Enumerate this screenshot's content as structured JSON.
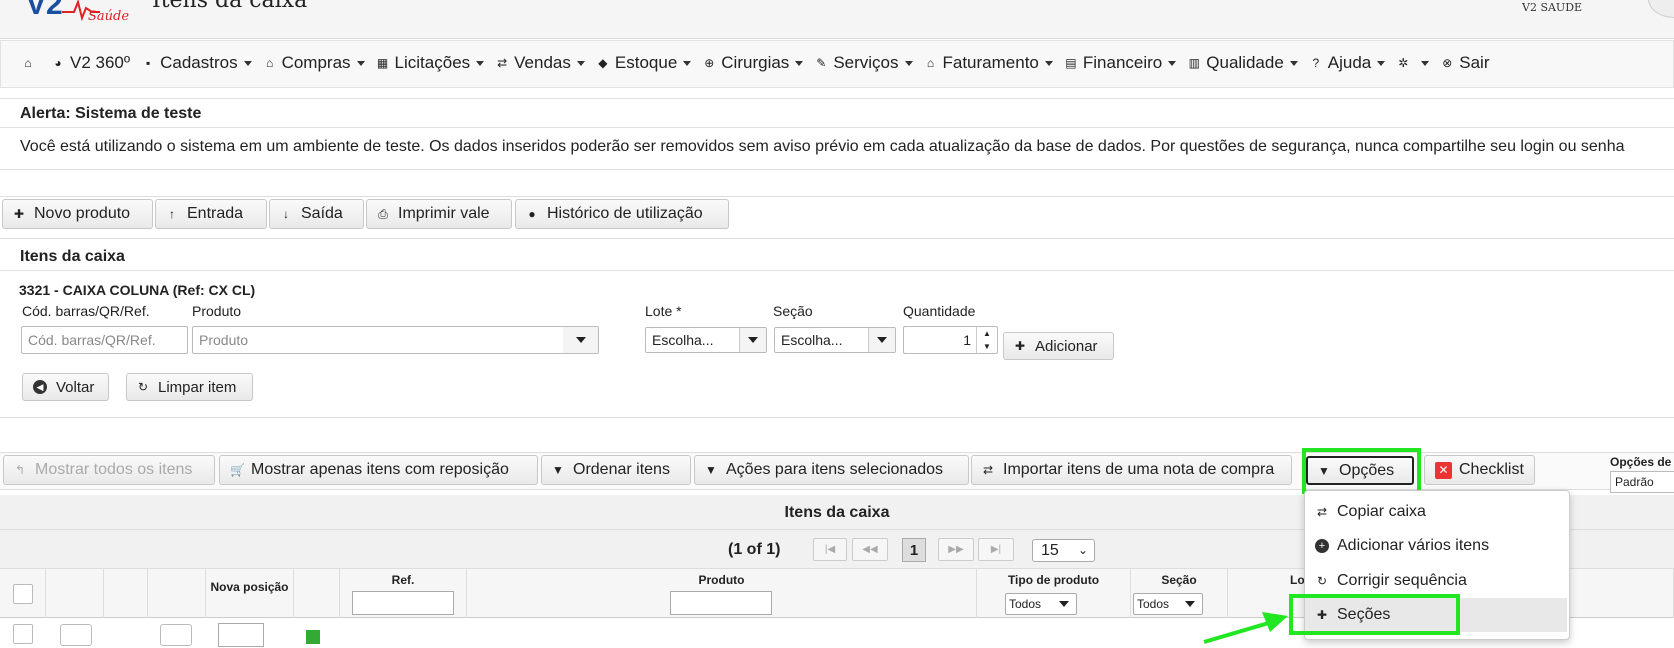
{
  "header": {
    "title": "Itens da caixa",
    "brand": "V2 SAUDE",
    "logo_text": "Saúde"
  },
  "nav": {
    "items": [
      {
        "icon": "home-icon",
        "label": ""
      },
      {
        "icon": "pie-chart-icon",
        "label": "V2 360º"
      },
      {
        "icon": "save-icon",
        "label": "Cadastros"
      },
      {
        "icon": "bank-icon",
        "label": "Compras"
      },
      {
        "icon": "building-icon",
        "label": "Licitações"
      },
      {
        "icon": "swap-icon",
        "label": "Vendas"
      },
      {
        "icon": "tag-icon",
        "label": "Estoque"
      },
      {
        "icon": "plus-circle-icon",
        "label": "Cirurgias"
      },
      {
        "icon": "wrench-icon",
        "label": "Serviços"
      },
      {
        "icon": "bank-icon",
        "label": "Faturamento"
      },
      {
        "icon": "calculator-icon",
        "label": "Financeiro"
      },
      {
        "icon": "book-icon",
        "label": "Qualidade"
      },
      {
        "icon": "question-icon",
        "label": "Ajuda"
      },
      {
        "icon": "gear-icon",
        "label": ""
      },
      {
        "icon": "close-circle-icon",
        "label": "Sair"
      }
    ]
  },
  "alert": {
    "title": "Alerta: Sistema de teste",
    "text": "Você está utilizando o sistema em um ambiente de teste. Os dados inseridos poderão ser removidos sem aviso prévio em cada atualização da base de dados. Por questões de segurança, nunca compartilhe seu login ou senha"
  },
  "toolbar": {
    "novo": "Novo produto",
    "entrada": "Entrada",
    "saida": "Saída",
    "imprimir": "Imprimir vale",
    "historico": "Histórico de utilização"
  },
  "form": {
    "section_title": "Itens da caixa",
    "box_title": "3321 - CAIXA COLUNA (Ref: CX CL)",
    "barcode_label": "Cód. barras/QR/Ref.",
    "barcode_placeholder": "Cód. barras/QR/Ref.",
    "product_label": "Produto",
    "product_placeholder": "Produto",
    "lote_label": "Lote *",
    "lote_value": "Escolha...",
    "secao_label": "Seção",
    "secao_value": "Escolha...",
    "qty_label": "Quantidade",
    "qty_value": "1",
    "add_label": "Adicionar",
    "back_label": "Voltar",
    "clear_label": "Limpar item"
  },
  "options_bar": {
    "show_all": "Mostrar todos os itens",
    "show_repo": "Mostrar apenas itens com reposição",
    "order": "Ordenar itens",
    "actions": "Ações para itens selecionados",
    "import": "Importar itens de uma nota de compra",
    "opcoes": "Opções",
    "checklist": "Checklist",
    "opcoes_de_label": "Opções de",
    "opcoes_de_value": "Padrão"
  },
  "table": {
    "title": "Itens da caixa",
    "pager": "(1 of 1)",
    "current_page": "1",
    "per_page": "15",
    "columns": {
      "nova_posicao": "Nova posição",
      "ref": "Ref.",
      "produto": "Produto",
      "tipo": "Tipo de produto",
      "tipo_filter": "Todos",
      "secao": "Seção",
      "secao_filter": "Todos",
      "lote": "Lo"
    }
  },
  "menu": {
    "items": [
      {
        "icon": "swap-icon",
        "label": "Copiar caixa"
      },
      {
        "icon": "plus-circle-icon",
        "label": "Adicionar vários itens"
      },
      {
        "icon": "refresh-icon",
        "label": "Corrigir sequência"
      },
      {
        "icon": "plus-icon",
        "label": "Seções"
      }
    ]
  },
  "colors": {
    "highlight": "#22e622",
    "danger": "#e33333",
    "logo_blue": "#1a4fa0",
    "logo_red": "#d22"
  }
}
